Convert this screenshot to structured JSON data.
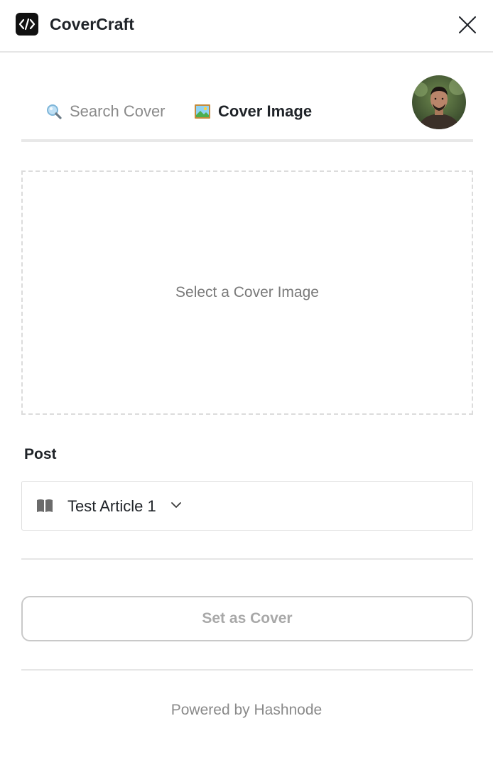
{
  "app": {
    "title": "CoverCraft",
    "logo_icon": "code-brackets-icon"
  },
  "header": {
    "close_icon": "close-icon"
  },
  "tabs": [
    {
      "label": "Search Cover",
      "icon": "magnifying-glass-icon",
      "active": false
    },
    {
      "label": "Cover Image",
      "icon": "framed-picture-icon",
      "active": true
    }
  ],
  "dropzone": {
    "text": "Select a Cover Image"
  },
  "post": {
    "label": "Post",
    "icon": "book-icon",
    "selected": "Test Article 1"
  },
  "actions": {
    "set_cover_label": "Set as Cover"
  },
  "footer": {
    "text": "Powered by Hashnode"
  },
  "colors": {
    "brand_dark": "#111111",
    "muted_text": "#8a8a8a",
    "border": "#dcdcdc"
  }
}
